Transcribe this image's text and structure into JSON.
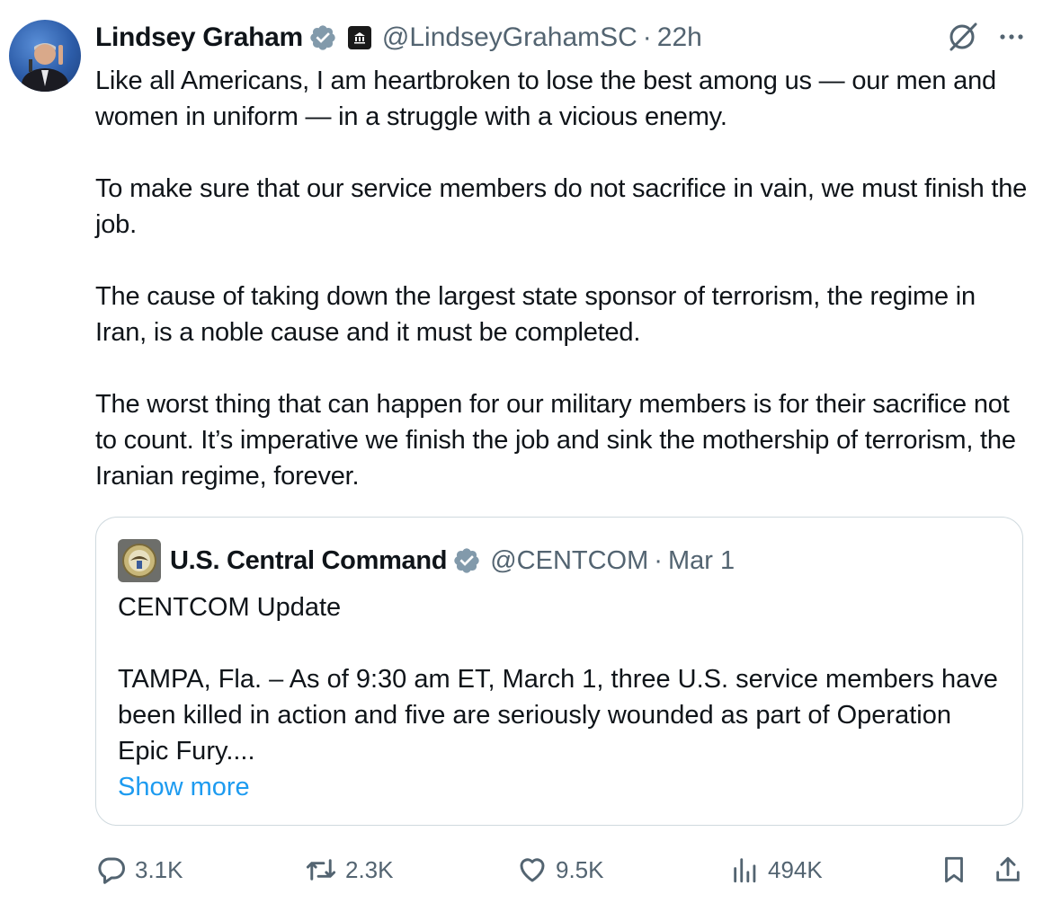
{
  "tweet": {
    "author_name": "Lindsey Graham",
    "handle": "@LindseyGrahamSC",
    "separator": "·",
    "time": "22h",
    "paragraphs": [
      "Like all Americans, I am heartbroken to lose the best among us — our men and women in uniform — in a struggle with a vicious enemy.",
      "To make sure that our service members do not sacrifice in vain, we must finish the job.",
      "The cause of taking down the largest state sponsor of terrorism, the regime in Iran, is a noble cause and it must be completed.",
      "The worst thing that can happen for our military members is for their sacrifice not to count. It’s imperative we finish the job and sink the mothership of terrorism, the Iranian regime, forever."
    ]
  },
  "quote": {
    "author_name": "U.S. Central Command",
    "handle": "@CENTCOM",
    "separator": "·",
    "time": "Mar 1",
    "title_line": "CENTCOM Update",
    "body": "TAMPA, Fla. – As of 9:30 am ET, March 1, three U.S. service members have been killed in action and five are seriously wounded as part of Operation Epic Fury....",
    "show_more": "Show more"
  },
  "actions": {
    "replies": "3.1K",
    "reposts": "2.3K",
    "likes": "9.5K",
    "views": "494K"
  },
  "colors": {
    "text": "#0f1419",
    "secondary": "#536471",
    "link": "#1d9bf0",
    "verified": "#829aab",
    "border": "#cfd9de"
  }
}
